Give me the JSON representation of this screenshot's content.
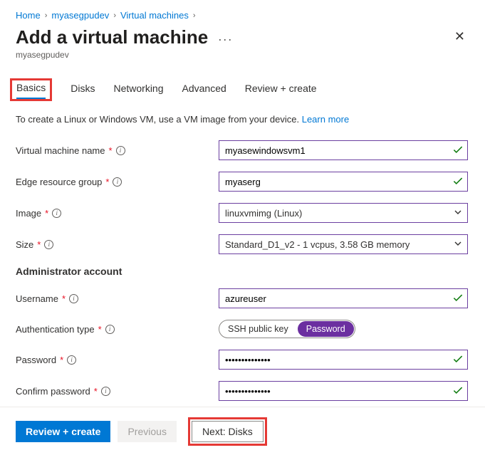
{
  "breadcrumb": {
    "home": "Home",
    "level1": "myasegpudev",
    "level2": "Virtual machines"
  },
  "header": {
    "title": "Add a virtual machine",
    "subtitle": "myasegpudev"
  },
  "tabs": {
    "basics": "Basics",
    "disks": "Disks",
    "networking": "Networking",
    "advanced": "Advanced",
    "review": "Review + create"
  },
  "intro": {
    "text": "To create a Linux or Windows VM, use a VM image from your device. ",
    "link": "Learn more"
  },
  "fields": {
    "vm_name": {
      "label": "Virtual machine name",
      "value": "myasewindowsvm1"
    },
    "erg": {
      "label": "Edge resource group",
      "value": "myaserg"
    },
    "image": {
      "label": "Image",
      "value": "linuxvmimg (Linux)"
    },
    "size": {
      "label": "Size",
      "value": "Standard_D1_v2 - 1 vcpus, 3.58 GB memory"
    },
    "admin_section": "Administrator account",
    "username": {
      "label": "Username",
      "value": "azureuser"
    },
    "authtype": {
      "label": "Authentication type",
      "opt1": "SSH public key",
      "opt2": "Password"
    },
    "password": {
      "label": "Password",
      "value": "••••••••••••••"
    },
    "confirm": {
      "label": "Confirm password",
      "value": "••••••••••••••"
    }
  },
  "footer": {
    "review": "Review + create",
    "prev": "Previous",
    "next": "Next: Disks"
  }
}
